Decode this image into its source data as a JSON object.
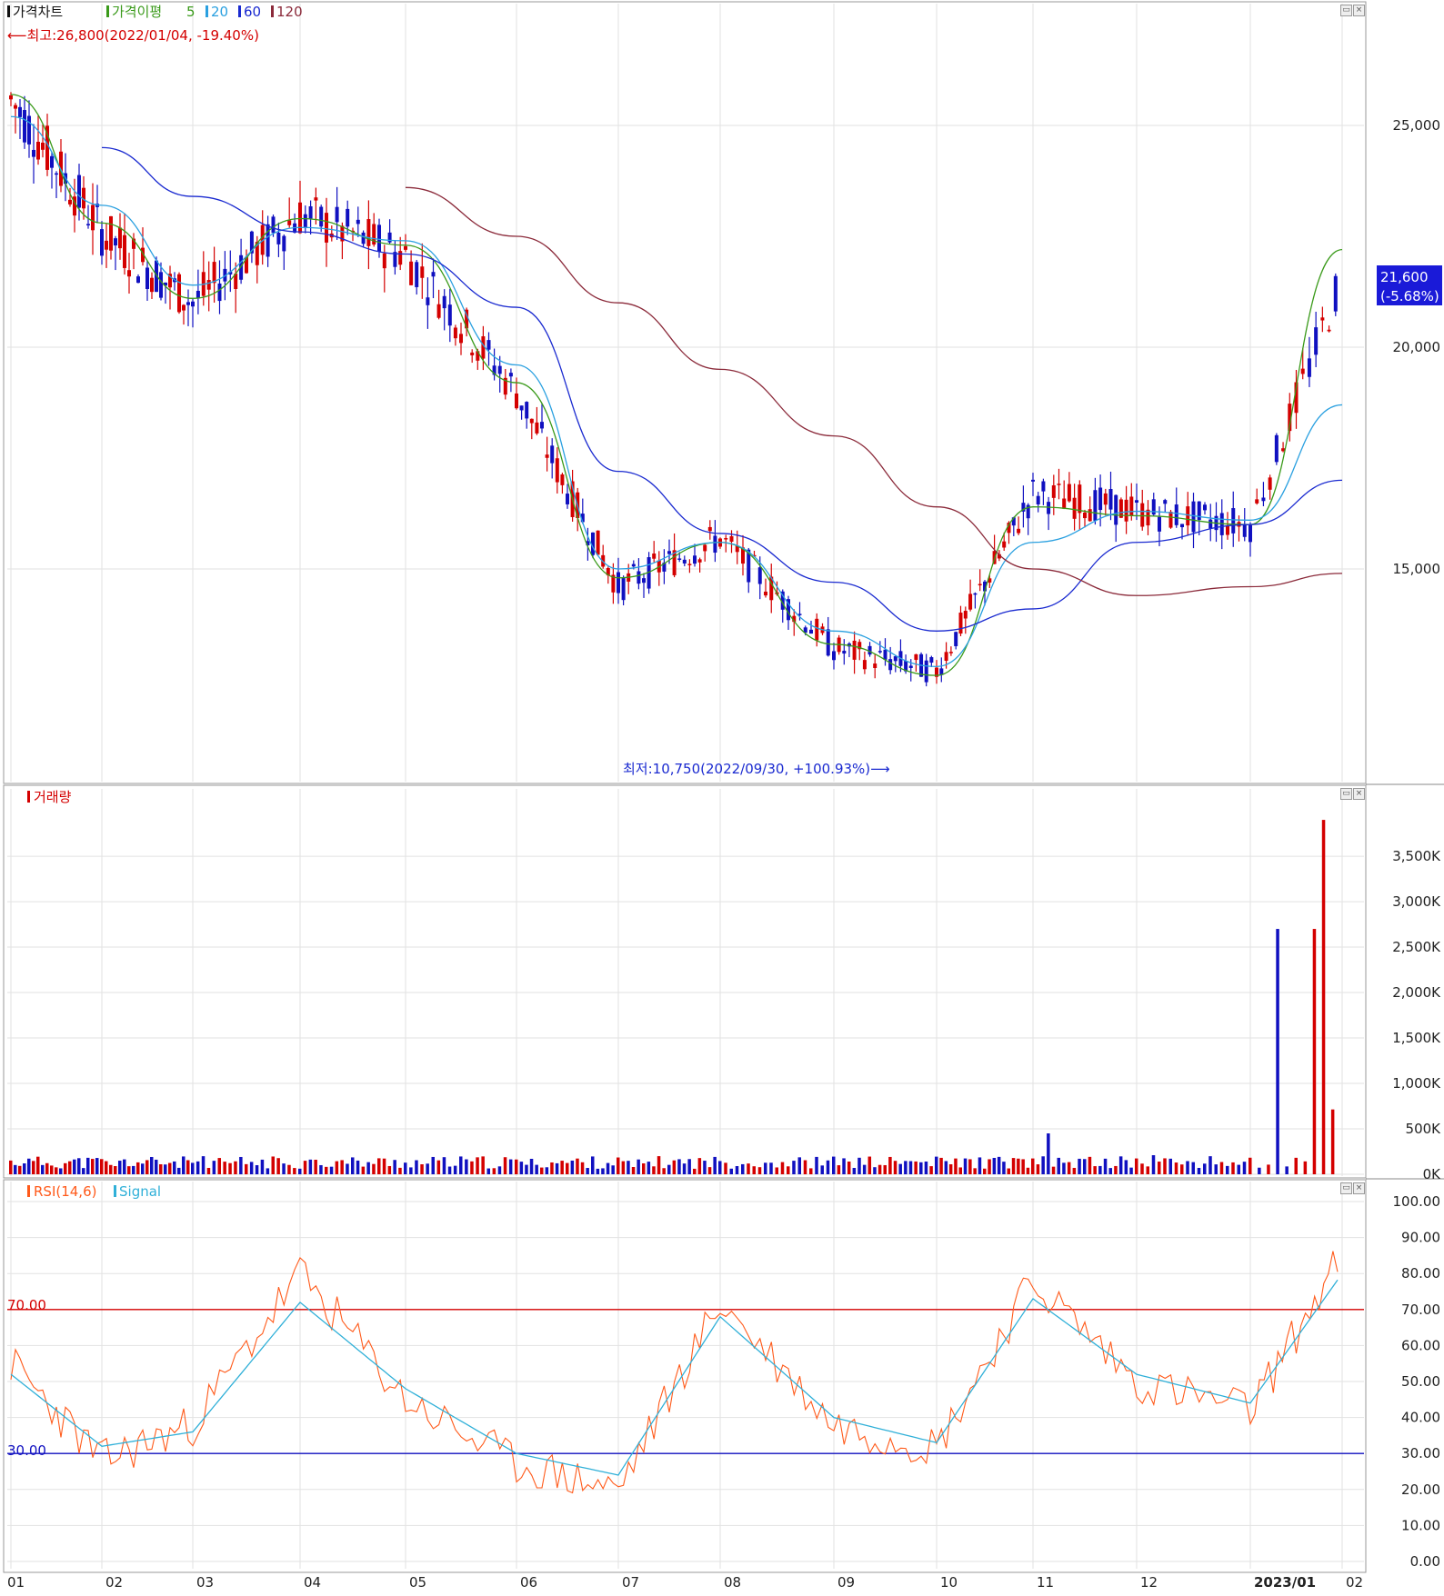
{
  "price_panel": {
    "legend": {
      "title": "가격차트",
      "ma_label": "가격이평",
      "ma_periods": [
        "5",
        "20",
        "60",
        "120"
      ],
      "ma_colors": [
        "#3a9a1a",
        "#2aa0e0",
        "#1a2ad0",
        "#8b2a3a"
      ]
    },
    "high_annotation": "최고:26,800(2022/01/04, -19.40%)",
    "low_annotation": "최저:10,750(2022/09/30, +100.93%)",
    "current_price": "21,600",
    "current_change": "(-5.68%)",
    "y_ticks": [
      "25,000",
      "20,000",
      "15,000"
    ]
  },
  "volume_panel": {
    "legend": "거래량",
    "y_ticks": [
      "3,500K",
      "3,000K",
      "2,500K",
      "2,000K",
      "1,500K",
      "1,000K",
      "500K",
      "0K"
    ]
  },
  "rsi_panel": {
    "legend_rsi": "RSI(14,6)",
    "legend_signal": "Signal",
    "upper_line_label": "70.00",
    "lower_line_label": "30.00",
    "y_ticks": [
      "100.00",
      "90.00",
      "80.00",
      "70.00",
      "60.00",
      "50.00",
      "40.00",
      "30.00",
      "20.00",
      "10.00",
      "0.00"
    ]
  },
  "x_axis": {
    "labels": [
      "01",
      "02",
      "03",
      "04",
      "05",
      "06",
      "07",
      "08",
      "09",
      "10",
      "11",
      "12",
      "2023/01",
      "02"
    ]
  },
  "colors": {
    "up": "#d40000",
    "down": "#1010c0",
    "grid": "#e2e2e2",
    "rsi": "#ff5a1a",
    "signal": "#30b0d8",
    "upper": "#d40000",
    "lower": "#1010c0"
  },
  "chart_data": [
    {
      "type": "candlestick",
      "title": "가격차트",
      "ylim": [
        10000,
        27000
      ],
      "x": [
        "2022/01",
        "2022/02",
        "2022/03",
        "2022/04",
        "2022/05",
        "2022/06",
        "2022/07",
        "2022/08",
        "2022/09",
        "2022/10",
        "2022/11",
        "2022/12",
        "2023/01",
        "2023/02"
      ],
      "series": [
        {
          "name": "close",
          "values": [
            25600,
            22600,
            21000,
            23000,
            22100,
            19000,
            14600,
            15700,
            13200,
            12700,
            16700,
            16300,
            16000,
            21600
          ]
        },
        {
          "name": "5",
          "values": [
            25700,
            22800,
            21100,
            22900,
            22300,
            19200,
            14800,
            15600,
            13300,
            12600,
            16400,
            16200,
            16000,
            22200
          ]
        },
        {
          "name": "20",
          "values": [
            25200,
            23200,
            21400,
            22700,
            22400,
            19600,
            15000,
            15600,
            13600,
            12800,
            15600,
            16300,
            16100,
            18700
          ]
        },
        {
          "name": "60",
          "values": [
            null,
            24500,
            23400,
            22600,
            22100,
            20900,
            17200,
            15800,
            14700,
            13600,
            14100,
            15600,
            16000,
            17000
          ]
        },
        {
          "name": "120",
          "values": [
            null,
            null,
            null,
            null,
            23600,
            22500,
            21000,
            19500,
            18000,
            16400,
            15000,
            14400,
            14600,
            14900
          ]
        }
      ],
      "high": {
        "value": 26800,
        "date": "2022/01/04"
      },
      "low": {
        "value": 10750,
        "date": "2022/09/30"
      }
    },
    {
      "type": "bar",
      "title": "거래량",
      "unit": "K",
      "ylim": [
        0,
        4000
      ],
      "categories": [
        "2022/01",
        "2022/02",
        "2022/03",
        "2022/04",
        "2022/05",
        "2022/06",
        "2022/07",
        "2022/08",
        "2022/09",
        "2022/10",
        "2022/11",
        "2022/12",
        "2023/01",
        "2023/02"
      ],
      "values": [
        120,
        90,
        70,
        160,
        110,
        170,
        80,
        90,
        140,
        110,
        450,
        210,
        2700,
        3900
      ],
      "peak": 3900
    },
    {
      "type": "line",
      "title": "RSI(14,6)",
      "ylim": [
        0,
        100
      ],
      "categories": [
        "2022/01",
        "2022/02",
        "2022/03",
        "2022/04",
        "2022/05",
        "2022/06",
        "2022/07",
        "2022/08",
        "2022/09",
        "2022/10",
        "2022/11",
        "2022/12",
        "2023/01",
        "2023/02"
      ],
      "series": [
        {
          "name": "RSI(14,6)",
          "values": [
            55,
            28,
            38,
            80,
            45,
            27,
            20,
            72,
            38,
            32,
            78,
            50,
            42,
            85
          ]
        },
        {
          "name": "Signal",
          "values": [
            52,
            32,
            36,
            72,
            48,
            30,
            24,
            68,
            40,
            33,
            73,
            52,
            44,
            80
          ]
        }
      ],
      "reference_lines": [
        70,
        30
      ]
    }
  ]
}
